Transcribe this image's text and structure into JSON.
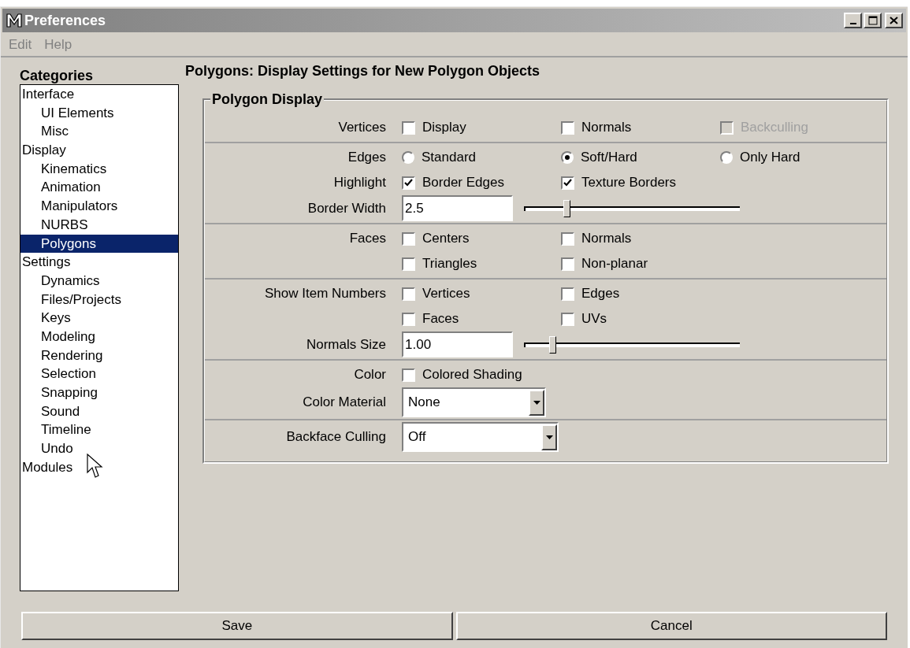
{
  "window": {
    "title": "Preferences"
  },
  "menu": [
    "Edit",
    "Help"
  ],
  "sidebar": {
    "title": "Categories",
    "items": [
      {
        "label": "Interface",
        "selected": false,
        "children": [
          {
            "label": "UI Elements",
            "selected": false
          },
          {
            "label": "Misc",
            "selected": false
          }
        ]
      },
      {
        "label": "Display",
        "selected": false,
        "children": [
          {
            "label": "Kinematics",
            "selected": false
          },
          {
            "label": "Animation",
            "selected": false
          },
          {
            "label": "Manipulators",
            "selected": false
          },
          {
            "label": "NURBS",
            "selected": false
          },
          {
            "label": "Polygons",
            "selected": true
          }
        ]
      },
      {
        "label": "Settings",
        "selected": false,
        "children": [
          {
            "label": "Dynamics",
            "selected": false
          },
          {
            "label": "Files/Projects",
            "selected": false
          },
          {
            "label": "Keys",
            "selected": false
          },
          {
            "label": "Modeling",
            "selected": false
          },
          {
            "label": "Rendering",
            "selected": false
          },
          {
            "label": "Selection",
            "selected": false
          },
          {
            "label": "Snapping",
            "selected": false
          },
          {
            "label": "Sound",
            "selected": false
          },
          {
            "label": "Timeline",
            "selected": false
          },
          {
            "label": "Undo",
            "selected": false
          }
        ]
      },
      {
        "label": "Modules",
        "selected": false
      }
    ]
  },
  "heading": "Polygons: Display Settings for New Polygon Objects",
  "group": {
    "title": "Polygon Display",
    "sections": [
      {
        "rows": [
          {
            "kind": "checks",
            "label": "Vertices",
            "options": [
              {
                "label": "Display",
                "checked": false,
                "disabled": false
              },
              {
                "label": "Normals",
                "checked": false,
                "disabled": false
              },
              {
                "label": "Backculling",
                "checked": false,
                "disabled": true
              }
            ]
          }
        ]
      },
      {
        "rows": [
          {
            "kind": "radios",
            "label": "Edges",
            "options": [
              {
                "label": "Standard",
                "selected": false
              },
              {
                "label": "Soft/Hard",
                "selected": true
              },
              {
                "label": "Only Hard",
                "selected": false
              }
            ]
          },
          {
            "kind": "checks",
            "label": "Highlight",
            "options": [
              {
                "label": "Border Edges",
                "checked": true,
                "disabled": false
              },
              {
                "label": "Texture Borders",
                "checked": true,
                "disabled": false
              }
            ]
          },
          {
            "kind": "slider",
            "label": "Border Width",
            "value": "2.5",
            "level": 0.19
          }
        ]
      },
      {
        "rows": [
          {
            "kind": "checks",
            "label": "Faces",
            "options": [
              {
                "label": "Centers",
                "checked": false,
                "disabled": false
              },
              {
                "label": "Normals",
                "checked": false,
                "disabled": false
              }
            ]
          },
          {
            "kind": "checks",
            "options": [
              {
                "label": "Triangles",
                "checked": false,
                "disabled": false
              },
              {
                "label": "Non-planar",
                "checked": false,
                "disabled": false
              }
            ]
          }
        ]
      },
      {
        "rows": [
          {
            "kind": "checks",
            "label": "Show Item Numbers",
            "options": [
              {
                "label": "Vertices",
                "checked": false,
                "disabled": false
              },
              {
                "label": "Edges",
                "checked": false,
                "disabled": false
              }
            ]
          },
          {
            "kind": "checks",
            "options": [
              {
                "label": "Faces",
                "checked": false,
                "disabled": false
              },
              {
                "label": "UVs",
                "checked": false,
                "disabled": false
              }
            ]
          },
          {
            "kind": "slider",
            "label": "Normals Size",
            "value": "1.00",
            "level": 0.12
          }
        ]
      },
      {
        "rows": [
          {
            "kind": "checks",
            "label": "Color",
            "options": [
              {
                "label": "Colored Shading",
                "checked": false,
                "disabled": false
              }
            ]
          },
          {
            "kind": "dropdown",
            "label": "Color Material",
            "value": "None",
            "wide": false
          }
        ]
      },
      {
        "rows": [
          {
            "kind": "dropdown",
            "label": "Backface Culling",
            "value": "Off",
            "wide": true
          }
        ]
      }
    ]
  },
  "buttons": [
    "Save",
    "Cancel"
  ]
}
